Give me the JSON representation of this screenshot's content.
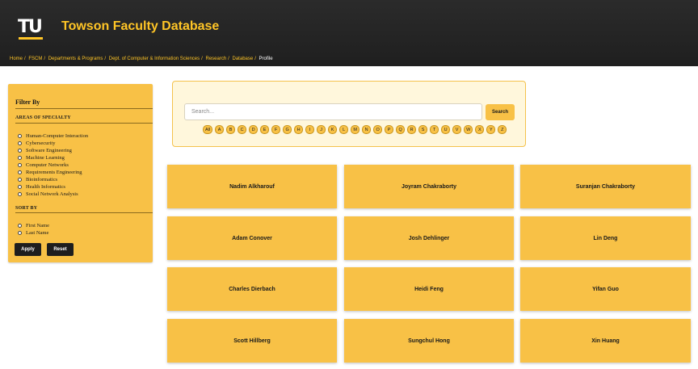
{
  "header": {
    "logo_text": "TU",
    "title": "Towson Faculty Database",
    "breadcrumb": [
      "Home",
      "FSCM",
      "Departments & Programs",
      "Dept. of Computer & Information Sciences",
      "Research",
      "Database"
    ],
    "breadcrumb_current": "Profile",
    "colors": {
      "background": "#222222",
      "accent": "#ffc526"
    }
  },
  "sidebar": {
    "title": "Filter By",
    "specialty_heading": "AREAS OF SPECIALTY",
    "specialties": [
      "Human-Computer Interaction",
      "Cybersecurity",
      "Software Engineering",
      "Machine Learning",
      "Computer Networks",
      "Requirements Engineering",
      "Bioinformatics",
      "Health Informatics",
      "Social Network Analysis"
    ],
    "sort_heading": "SORT BY",
    "sort_options": [
      "First Name",
      "Last Name"
    ],
    "apply_label": "Apply",
    "reset_label": "Reset",
    "colors": {
      "panel": "#f8c146",
      "button": "#1e1e1e"
    }
  },
  "search": {
    "placeholder": "Search...",
    "button_label": "Search",
    "letters": [
      "All",
      "A",
      "B",
      "C",
      "D",
      "E",
      "F",
      "G",
      "H",
      "I",
      "J",
      "K",
      "L",
      "M",
      "N",
      "O",
      "P",
      "Q",
      "R",
      "S",
      "T",
      "U",
      "V",
      "W",
      "X",
      "Y",
      "Z"
    ]
  },
  "faculty": [
    "Nadim Alkharouf",
    "Joyram Chakraborty",
    "Suranjan Chakraborty",
    "Adam Conover",
    "Josh Dehlinger",
    "Lin Deng",
    "Charles Dierbach",
    "Heidi Feng",
    "Yifan Guo",
    "Scott Hillberg",
    "Sungchul Hong",
    "Xin Huang"
  ]
}
